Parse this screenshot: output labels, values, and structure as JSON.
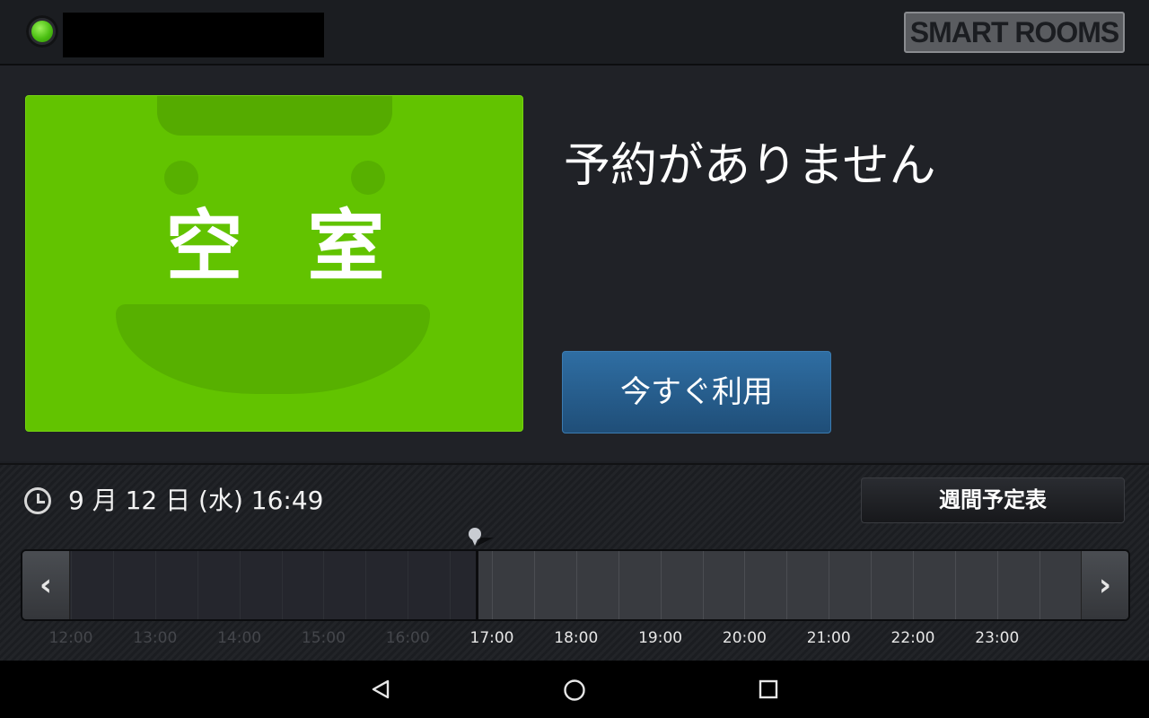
{
  "header": {
    "status": "available",
    "room_name": "",
    "logo_text": "SMART ROOMS"
  },
  "status_card": {
    "text": "空室",
    "color": "#62c300"
  },
  "main": {
    "message": "予約がありません",
    "use_now_label": "今すぐ利用"
  },
  "schedule": {
    "datetime": "9 月 12 日 (水)  16:49",
    "weekly_button_label": "週間予定表",
    "current_time": "16:49",
    "hours": [
      {
        "label": "12:00",
        "past": true
      },
      {
        "label": "13:00",
        "past": true
      },
      {
        "label": "14:00",
        "past": true
      },
      {
        "label": "15:00",
        "past": true
      },
      {
        "label": "16:00",
        "past": true
      },
      {
        "label": "17:00",
        "past": false
      },
      {
        "label": "18:00",
        "past": false
      },
      {
        "label": "19:00",
        "past": false
      },
      {
        "label": "20:00",
        "past": false
      },
      {
        "label": "21:00",
        "past": false
      },
      {
        "label": "22:00",
        "past": false
      },
      {
        "label": "23:00",
        "past": false
      }
    ],
    "prev_icon": "chevron-left-icon",
    "next_icon": "chevron-right-icon"
  },
  "system_nav": {
    "back_icon": "back-triangle-icon",
    "home_icon": "home-circle-icon",
    "recents_icon": "recents-square-icon"
  }
}
